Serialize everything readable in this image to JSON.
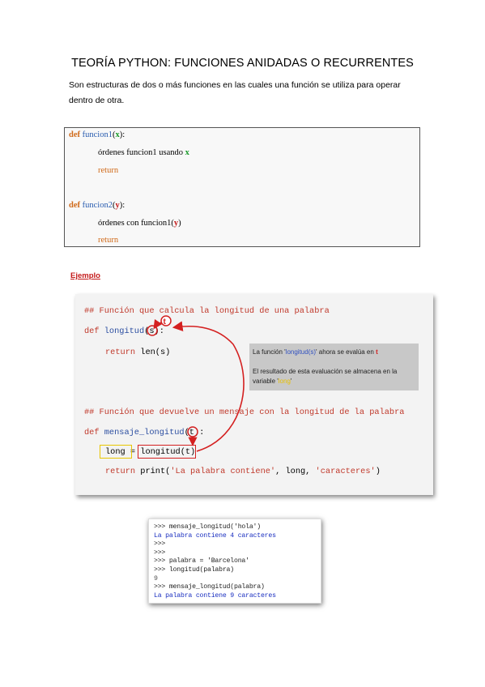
{
  "title": "TEORÍA PYTHON: FUNCIONES ANIDADAS O RECURRENTES",
  "intro": "Son estructuras de dos o más funciones en las cuales una función se utiliza para operar dentro de otra.",
  "syntax": {
    "def1": "def",
    "fn1": "funcion1",
    "param1": "x",
    "line2_prefix": "órdenes funcion1 usando ",
    "param1b": "x",
    "return1": "return",
    "def2": "def",
    "fn2": "funcion2",
    "param2": "y",
    "line5_prefix": "órdenes con funcion1",
    "param2b": "y",
    "return2": "return"
  },
  "ejemplo_label": "Ejemplo",
  "example": {
    "comment1": "## Función que calcula la longitud de una palabra",
    "def1": "def",
    "fn1": "longitud",
    "arg1": "s",
    "ret_kw": "return",
    "ret_call": "len(s)",
    "comment2": "## Función que devuelve un mensaje con la longitud de la palabra",
    "def2": "def",
    "fn2": "mensaje_longitud",
    "arg2": "t",
    "assign_var": "long",
    "assign_eq": " = ",
    "assign_call": "longitud(t)",
    "ret2_kw": "return",
    "ret2_print": "print(",
    "ret2_str1": "'La palabra contiene'",
    "ret2_mid": ", long, ",
    "ret2_str2": "'caracteres'",
    "ret2_end": ")",
    "marker_t": "t"
  },
  "note": {
    "line1_a": "La función '",
    "line1_fn": "longitud(s)",
    "line1_b": "' ahora se evalúa en ",
    "line1_t": "t",
    "line2_a": "El resultado de esta evaluación se almacena en la variable '",
    "line2_long": "long",
    "line2_b": "'"
  },
  "shell": [
    {
      "text": ">>> mensaje_longitud('hola')",
      "kind": "in"
    },
    {
      "text": "La palabra contiene 4 caracteres",
      "kind": "out"
    },
    {
      "text": ">>>",
      "kind": "in"
    },
    {
      "text": ">>>",
      "kind": "in"
    },
    {
      "text": ">>> palabra = 'Barcelona'",
      "kind": "in"
    },
    {
      "text": ">>> longitud(palabra)",
      "kind": "in"
    },
    {
      "text": "9",
      "kind": "num"
    },
    {
      "text": ">>> mensaje_longitud(palabra)",
      "kind": "in"
    },
    {
      "text": "La palabra contiene 9 caracteres",
      "kind": "out"
    }
  ],
  "colors": {
    "keyword": "#d06a1a",
    "function_name": "#2a5db0",
    "param_x": "#1a9a2a",
    "param_y": "#c41a1a",
    "annotation_red": "#d42020",
    "highlight_yellow": "#e8c600"
  }
}
